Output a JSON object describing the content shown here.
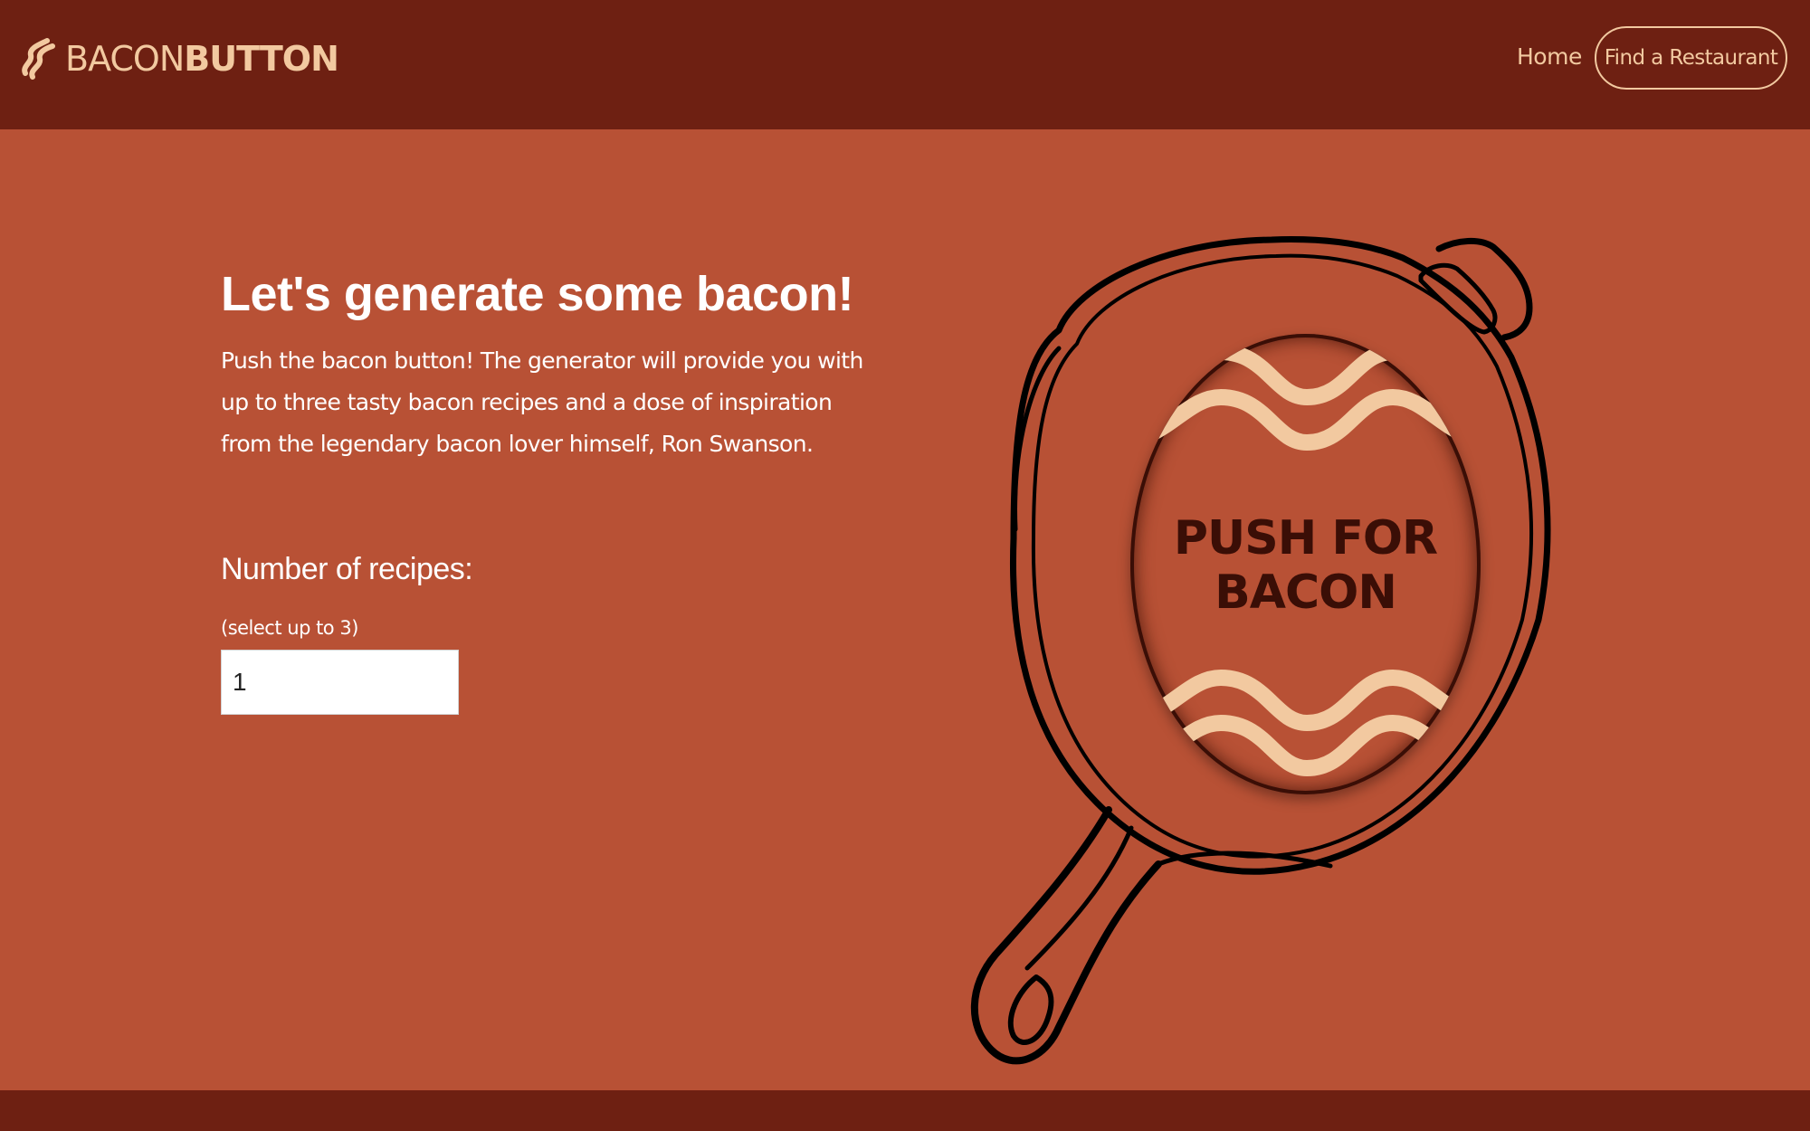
{
  "colors": {
    "nav_background": "#6e2012",
    "page_background": "#b85135",
    "accent": "#f2c9a0",
    "button_text": "#3a0e06"
  },
  "navbar": {
    "brand_light": "BACON",
    "brand_bold": "BUTTON",
    "brand_icon": "bacon-strip-icon",
    "links": {
      "home": "Home",
      "find_restaurant": "Find a Restaurant"
    }
  },
  "main": {
    "heading": "Let's generate some bacon!",
    "intro": "Push the bacon button! The generator will provide you with up to three tasty bacon recipes and a dose of inspiration from the legendary bacon lover himself, Ron Swanson.",
    "form": {
      "label": "Number of recipes:",
      "hint": "(select up to 3)",
      "value": "1"
    },
    "bacon_button": {
      "line1": "PUSH FOR",
      "line2": "BACON",
      "illustration": "cast-iron-skillet"
    }
  }
}
